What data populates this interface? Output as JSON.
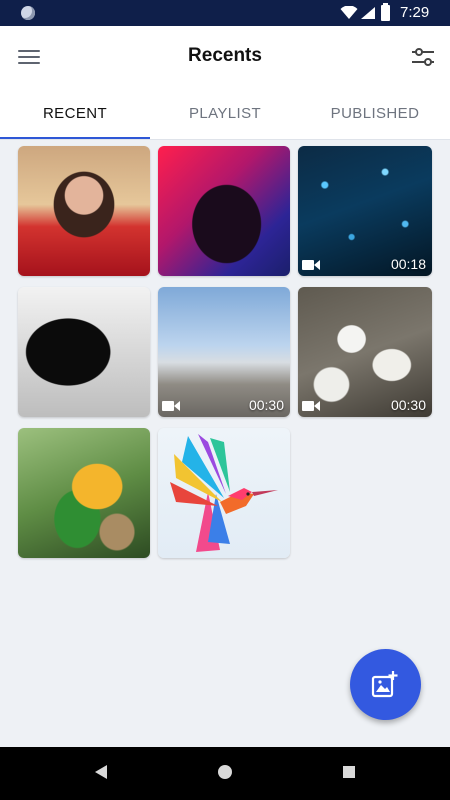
{
  "status_bar": {
    "time": "7:29"
  },
  "app_bar": {
    "title": "Recents"
  },
  "tabs": [
    {
      "label": "RECENT",
      "active": true
    },
    {
      "label": "PLAYLIST",
      "active": false
    },
    {
      "label": "PUBLISHED",
      "active": false
    }
  ],
  "media": [
    {
      "type": "image",
      "subject": "smiling woman portrait"
    },
    {
      "type": "image",
      "subject": "neon silhouette portrait"
    },
    {
      "type": "video",
      "subject": "blue particles",
      "duration": "00:18"
    },
    {
      "type": "image",
      "subject": "silhouette with glasses"
    },
    {
      "type": "video",
      "subject": "beach with gannets",
      "duration": "00:30"
    },
    {
      "type": "video",
      "subject": "gannets colony",
      "duration": "00:30"
    },
    {
      "type": "image",
      "subject": "parrot"
    },
    {
      "type": "image",
      "subject": "colorful hummingbird illustration"
    }
  ],
  "colors": {
    "accent": "#3359e0",
    "tab_indicator": "#2e57d6",
    "status_bar": "#0f1f4a"
  },
  "icons": {
    "fab": "add-photo-icon",
    "menu": "hamburger-menu-icon",
    "filter": "sliders-filter-icon"
  }
}
